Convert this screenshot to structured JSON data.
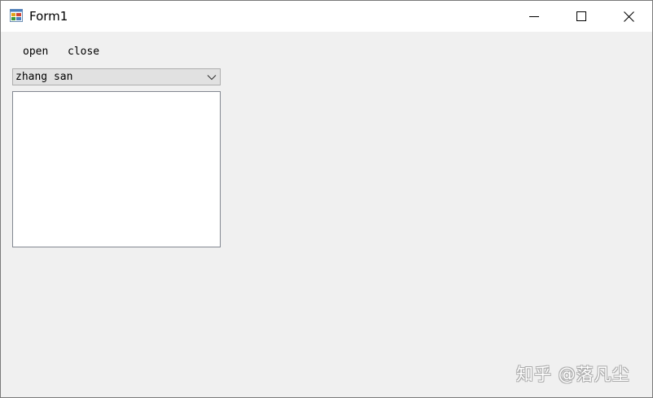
{
  "window": {
    "title": "Form1",
    "icon": "form-app-icon"
  },
  "caption_buttons": {
    "minimize_icon": "minimize-icon",
    "maximize_icon": "maximize-icon",
    "close_icon": "close-icon"
  },
  "menu": {
    "items": [
      {
        "label": "open"
      },
      {
        "label": "close"
      }
    ]
  },
  "combo": {
    "selected": "zhang san",
    "arrow_icon": "chevron-down-icon"
  },
  "listbox": {
    "items": []
  },
  "watermark": {
    "text": "知乎 @落凡尘"
  }
}
